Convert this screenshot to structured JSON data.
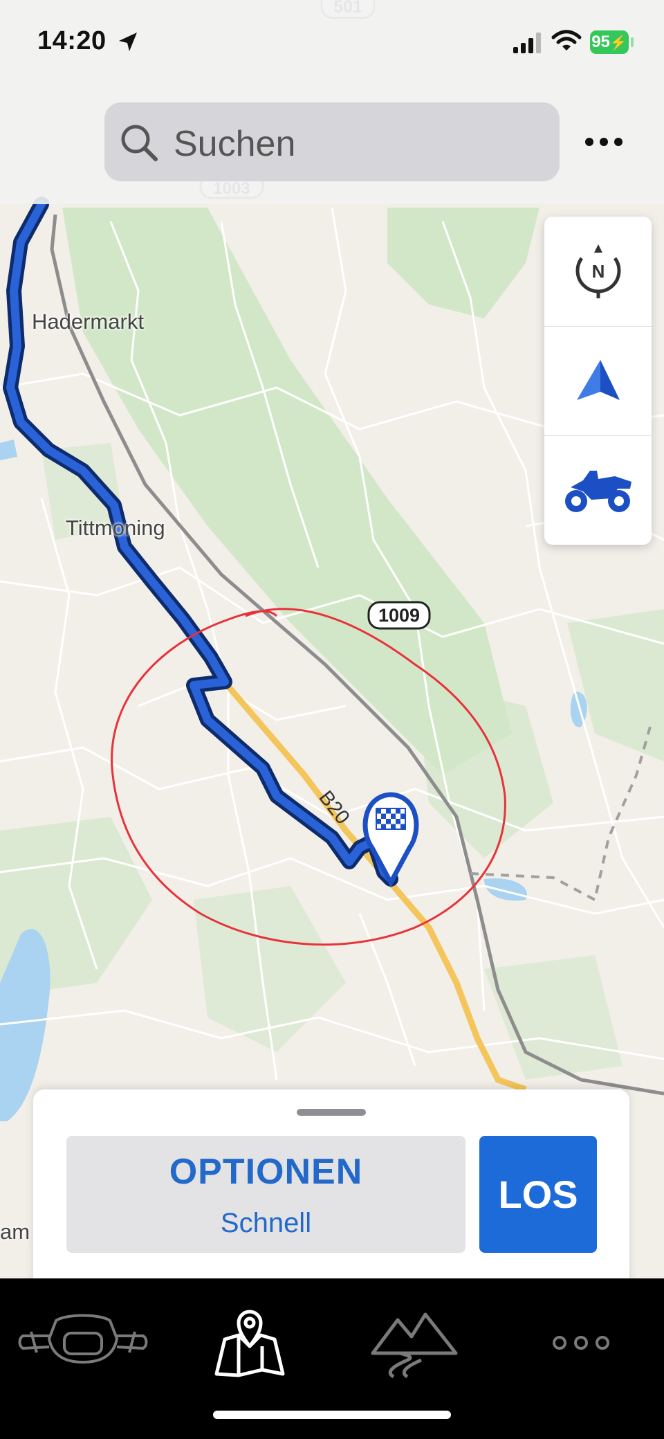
{
  "status_bar": {
    "time": "14:20",
    "battery": "95"
  },
  "search": {
    "placeholder": "Suchen"
  },
  "map": {
    "places": [
      "Hadermarkt",
      "Tittmoning",
      "am"
    ],
    "roads": {
      "shield_1009": "1009",
      "shield_501": "501",
      "shield_1003": "1003",
      "b20": "B20"
    }
  },
  "controls": {
    "compass_letter": "N",
    "icons": [
      "compass-icon",
      "navigation-arrow-icon",
      "motorcycle-icon"
    ]
  },
  "bottom_sheet": {
    "options_label": "OPTIONEN",
    "options_sub": "Schnell",
    "go_label": "LOS"
  },
  "tab_bar": {
    "items": [
      "bike-dashboard-icon",
      "map-icon",
      "mountains-road-icon",
      "more-dots-icon"
    ],
    "active_index": 1
  },
  "colors": {
    "route": "#1a4fc4",
    "accent": "#1d6ad9",
    "annotation": "#e8323a",
    "battery": "#34c759"
  }
}
